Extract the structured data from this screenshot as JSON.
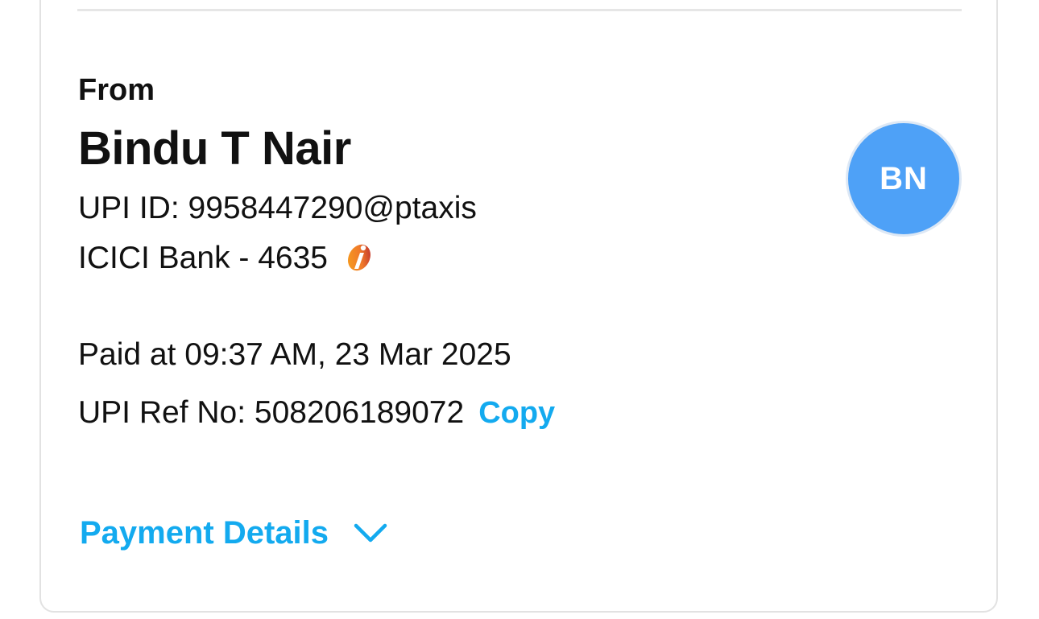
{
  "from_section": {
    "label": "From",
    "sender_name": "Bindu T Nair",
    "upi_id": "UPI ID: 9958447290@ptaxis",
    "bank": "ICICI Bank - 4635",
    "bank_logo_icon": "icici-bank-logo-icon",
    "avatar_initials": "BN"
  },
  "transaction": {
    "paid_at": "Paid at 09:37 AM, 23 Mar 2025",
    "ref_no": "UPI Ref No: 508206189072",
    "copy_label": "Copy"
  },
  "payment_details": {
    "label": "Payment Details",
    "icon": "chevron-down-icon"
  },
  "colors": {
    "accent": "#13aaef",
    "avatar_bg": "#4ea1f7",
    "text": "#111111",
    "border": "#e2e2e2"
  }
}
